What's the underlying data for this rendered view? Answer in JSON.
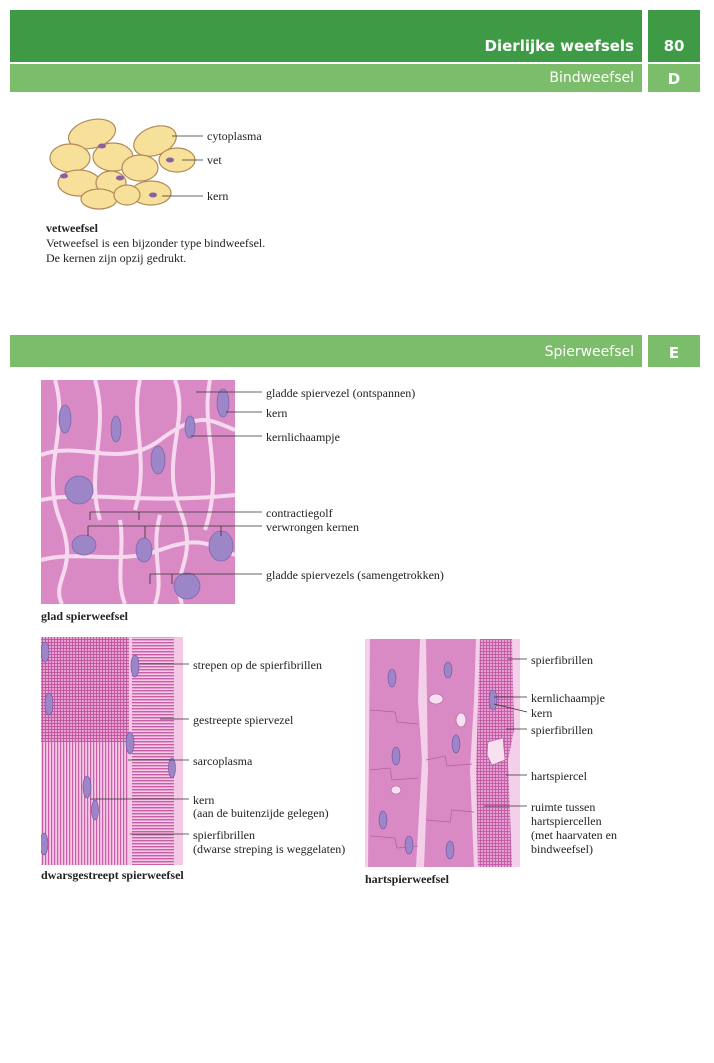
{
  "header": {
    "title": "Dierlijke weefsels",
    "page_number": "80",
    "section_d_title": "Bindweefsel",
    "section_d_letter": "D",
    "section_e_title": "Spierweefsel",
    "section_e_letter": "E"
  },
  "fat": {
    "labels": {
      "cytoplasm": "cytoplasma",
      "fat": "vet",
      "nucleus": "kern"
    },
    "caption_title": "vetweefsel",
    "caption_line1": "Vetweefsel is een bijzonder type bindweefsel.",
    "caption_line2": "De kernen zijn opzij gedrukt."
  },
  "smooth": {
    "labels": {
      "fiber_relaxed": "gladde spiervezel (ontspannen)",
      "nucleus": "kern",
      "nucleolus": "kernlichaampje",
      "wave": "contractiegolf",
      "twisted": "verwrongen kernen",
      "contracted": "gladde spiervezels (samengetrokken)"
    },
    "caption": "glad spierweefsel"
  },
  "striated": {
    "labels": {
      "stripes": "strepen op de spierfibrillen",
      "fiber": "gestreepte spiervezel",
      "sarcoplasm": "sarcoplasma",
      "nucleus": "kern",
      "nucleus_note": "(aan de buitenzijde gelegen)",
      "fibrils": "spierfibrillen",
      "fibrils_note": "(dwarse streping is weggelaten)"
    },
    "caption": "dwarsgestreept spierweefsel"
  },
  "cardiac": {
    "labels": {
      "fibrils_top": "spierfibrillen",
      "nucleolus": "kernlichaampje",
      "nucleus": "kern",
      "fibrils": "spierfibrillen",
      "cell": "hartspiercel",
      "space1": "ruimte tussen",
      "space2": "hartspiercellen",
      "space3": "(met haarvaten en",
      "space4": "bindweefsel)"
    },
    "caption": "hartspierweefsel"
  },
  "colors": {
    "header_dark": "#3f9a46",
    "header_light": "#7cbd6c",
    "fat_cell": "#f7e09a",
    "tissue_pink": "#d98ac4",
    "nucleus_purple": "#9c86c8"
  }
}
